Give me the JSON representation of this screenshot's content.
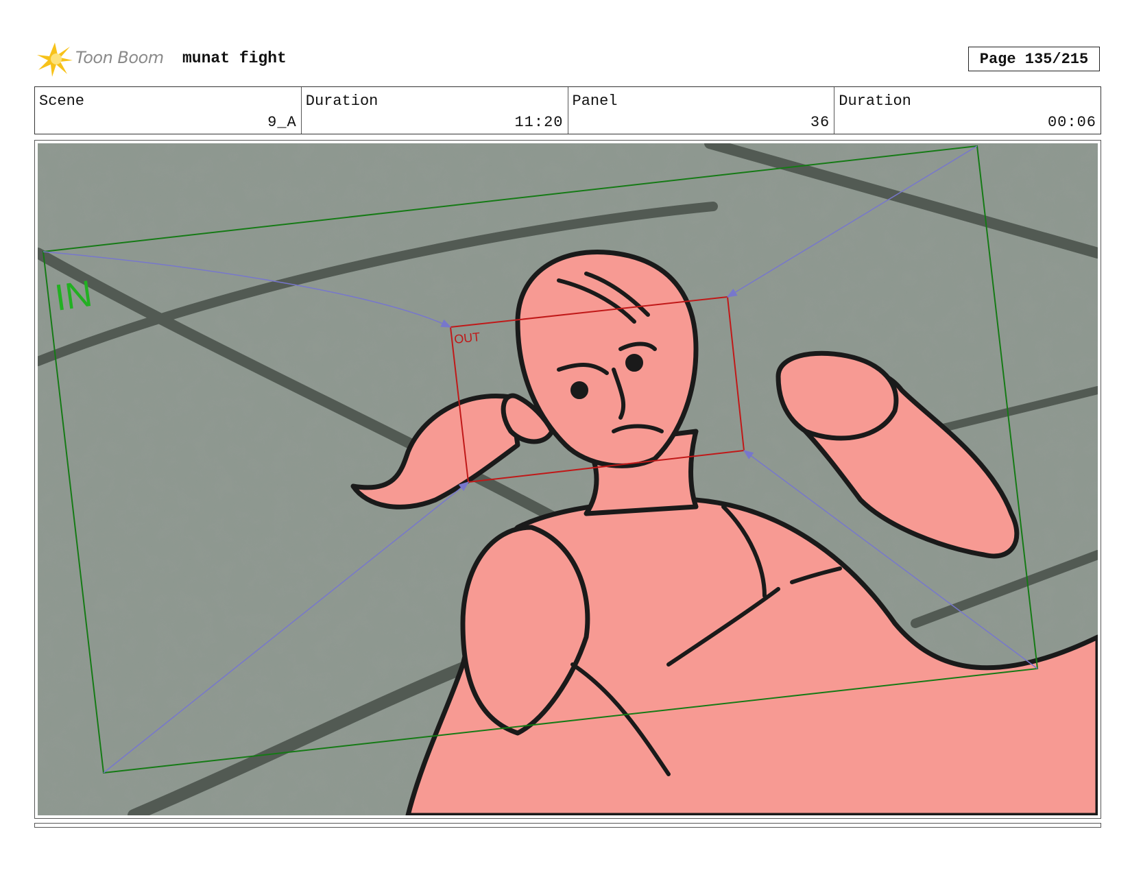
{
  "header": {
    "logo_text": "Toon Boom",
    "project_title": "munat fight",
    "page_label": "Page 135/215"
  },
  "info": {
    "scene_label": "Scene",
    "scene_value": "9_A",
    "scene_duration_label": "Duration",
    "scene_duration_value": "11:20",
    "panel_label": "Panel",
    "panel_value": "36",
    "panel_duration_label": "Duration",
    "panel_duration_value": "00:06"
  },
  "panel": {
    "camera_in_label": "IN",
    "camera_out_label": "OUT",
    "colors": {
      "ground": "#8e9890",
      "skin": "#f79a93",
      "camera_in": "#157a15",
      "camera_out": "#c01818",
      "camera_path": "#7777cc"
    }
  }
}
